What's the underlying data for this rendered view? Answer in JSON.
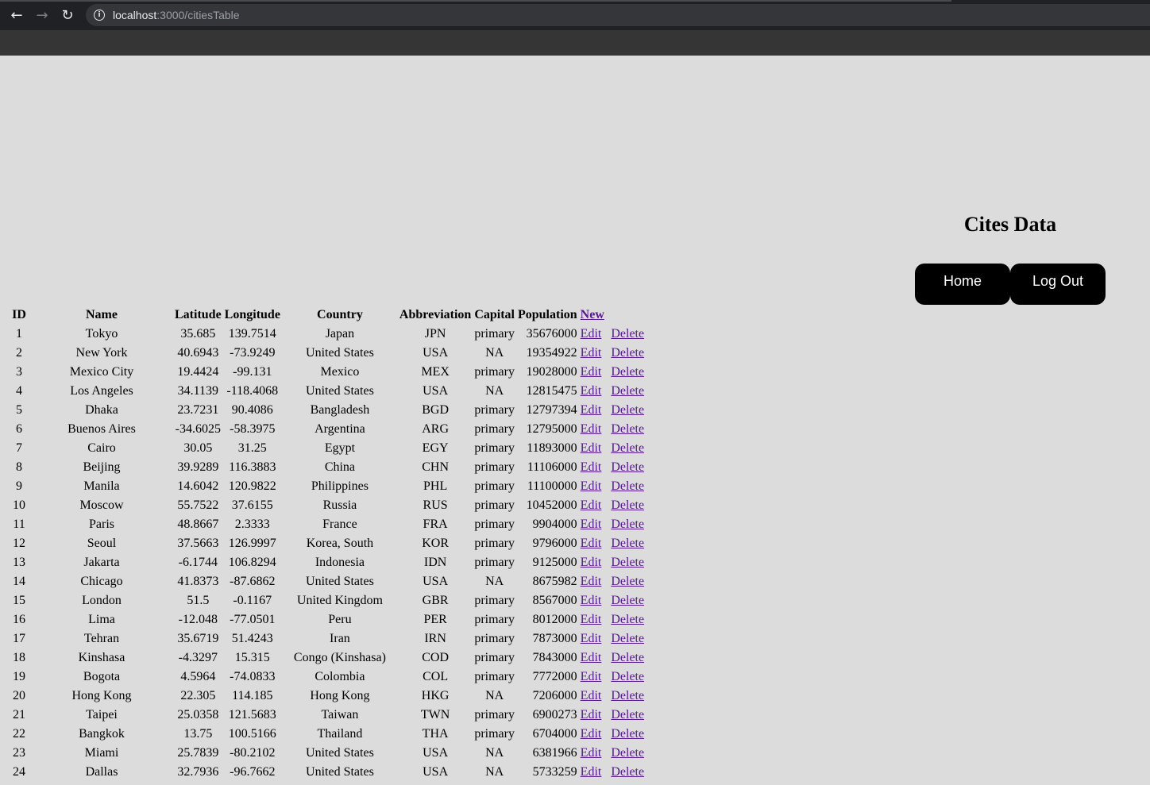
{
  "browser": {
    "url_host": "localhost",
    "url_path": ":3000/citiesTable"
  },
  "page": {
    "title": "Cites Data",
    "nav": {
      "home_label": "Home",
      "logout_label": "Log Out"
    }
  },
  "table": {
    "headers": {
      "id": "ID",
      "name": "Name",
      "lat": "Latitude",
      "lng": "Longitude",
      "country": "Country",
      "abbr": "Abbreviation",
      "capital": "Capital",
      "population": "Population",
      "new_link": " New"
    },
    "edit_label": " Edit",
    "delete_label": "Delete",
    "rows": [
      {
        "id": "1",
        "name": "Tokyo",
        "lat": "35.685",
        "lng": "139.7514",
        "country": "Japan",
        "abbr": "JPN",
        "capital": "primary",
        "pop": "35676000"
      },
      {
        "id": "2",
        "name": "New York",
        "lat": "40.6943",
        "lng": "-73.9249",
        "country": "United States",
        "abbr": "USA",
        "capital": "NA",
        "pop": "19354922"
      },
      {
        "id": "3",
        "name": "Mexico City",
        "lat": "19.4424",
        "lng": "-99.131",
        "country": "Mexico",
        "abbr": "MEX",
        "capital": "primary",
        "pop": "19028000"
      },
      {
        "id": "4",
        "name": "Los Angeles",
        "lat": "34.1139",
        "lng": "-118.4068",
        "country": "United States",
        "abbr": "USA",
        "capital": "NA",
        "pop": "12815475"
      },
      {
        "id": "5",
        "name": "Dhaka",
        "lat": "23.7231",
        "lng": "90.4086",
        "country": "Bangladesh",
        "abbr": "BGD",
        "capital": "primary",
        "pop": "12797394"
      },
      {
        "id": "6",
        "name": "Buenos Aires",
        "lat": "-34.6025",
        "lng": "-58.3975",
        "country": "Argentina",
        "abbr": "ARG",
        "capital": "primary",
        "pop": "12795000"
      },
      {
        "id": "7",
        "name": "Cairo",
        "lat": "30.05",
        "lng": "31.25",
        "country": "Egypt",
        "abbr": "EGY",
        "capital": "primary",
        "pop": "11893000"
      },
      {
        "id": "8",
        "name": "Beijing",
        "lat": "39.9289",
        "lng": "116.3883",
        "country": "China",
        "abbr": "CHN",
        "capital": "primary",
        "pop": "11106000"
      },
      {
        "id": "9",
        "name": "Manila",
        "lat": "14.6042",
        "lng": "120.9822",
        "country": "Philippines",
        "abbr": "PHL",
        "capital": "primary",
        "pop": "11100000"
      },
      {
        "id": "10",
        "name": "Moscow",
        "lat": "55.7522",
        "lng": "37.6155",
        "country": "Russia",
        "abbr": "RUS",
        "capital": "primary",
        "pop": "10452000"
      },
      {
        "id": "11",
        "name": "Paris",
        "lat": "48.8667",
        "lng": "2.3333",
        "country": "France",
        "abbr": "FRA",
        "capital": "primary",
        "pop": "9904000"
      },
      {
        "id": "12",
        "name": "Seoul",
        "lat": "37.5663",
        "lng": "126.9997",
        "country": "Korea, South",
        "abbr": "KOR",
        "capital": "primary",
        "pop": "9796000"
      },
      {
        "id": "13",
        "name": "Jakarta",
        "lat": "-6.1744",
        "lng": "106.8294",
        "country": "Indonesia",
        "abbr": "IDN",
        "capital": "primary",
        "pop": "9125000"
      },
      {
        "id": "14",
        "name": "Chicago",
        "lat": "41.8373",
        "lng": "-87.6862",
        "country": "United States",
        "abbr": "USA",
        "capital": "NA",
        "pop": "8675982"
      },
      {
        "id": "15",
        "name": "London",
        "lat": "51.5",
        "lng": "-0.1167",
        "country": "United Kingdom",
        "abbr": "GBR",
        "capital": "primary",
        "pop": "8567000"
      },
      {
        "id": "16",
        "name": "Lima",
        "lat": "-12.048",
        "lng": "-77.0501",
        "country": "Peru",
        "abbr": "PER",
        "capital": "primary",
        "pop": "8012000"
      },
      {
        "id": "17",
        "name": "Tehran",
        "lat": "35.6719",
        "lng": "51.4243",
        "country": "Iran",
        "abbr": "IRN",
        "capital": "primary",
        "pop": "7873000"
      },
      {
        "id": "18",
        "name": "Kinshasa",
        "lat": "-4.3297",
        "lng": "15.315",
        "country": "Congo (Kinshasa)",
        "abbr": "COD",
        "capital": "primary",
        "pop": "7843000"
      },
      {
        "id": "19",
        "name": "Bogota",
        "lat": "4.5964",
        "lng": "-74.0833",
        "country": "Colombia",
        "abbr": "COL",
        "capital": "primary",
        "pop": "7772000"
      },
      {
        "id": "20",
        "name": "Hong Kong",
        "lat": "22.305",
        "lng": "114.185",
        "country": "Hong Kong",
        "abbr": "HKG",
        "capital": "NA",
        "pop": "7206000"
      },
      {
        "id": "21",
        "name": "Taipei",
        "lat": "25.0358",
        "lng": "121.5683",
        "country": "Taiwan",
        "abbr": "TWN",
        "capital": "primary",
        "pop": "6900273"
      },
      {
        "id": "22",
        "name": "Bangkok",
        "lat": "13.75",
        "lng": "100.5166",
        "country": "Thailand",
        "abbr": "THA",
        "capital": "primary",
        "pop": "6704000"
      },
      {
        "id": "23",
        "name": "Miami",
        "lat": "25.7839",
        "lng": "-80.2102",
        "country": "United States",
        "abbr": "USA",
        "capital": "NA",
        "pop": "6381966"
      },
      {
        "id": "24",
        "name": "Dallas",
        "lat": "32.7936",
        "lng": "-96.7662",
        "country": "United States",
        "abbr": "USA",
        "capital": "NA",
        "pop": "5733259"
      }
    ]
  }
}
